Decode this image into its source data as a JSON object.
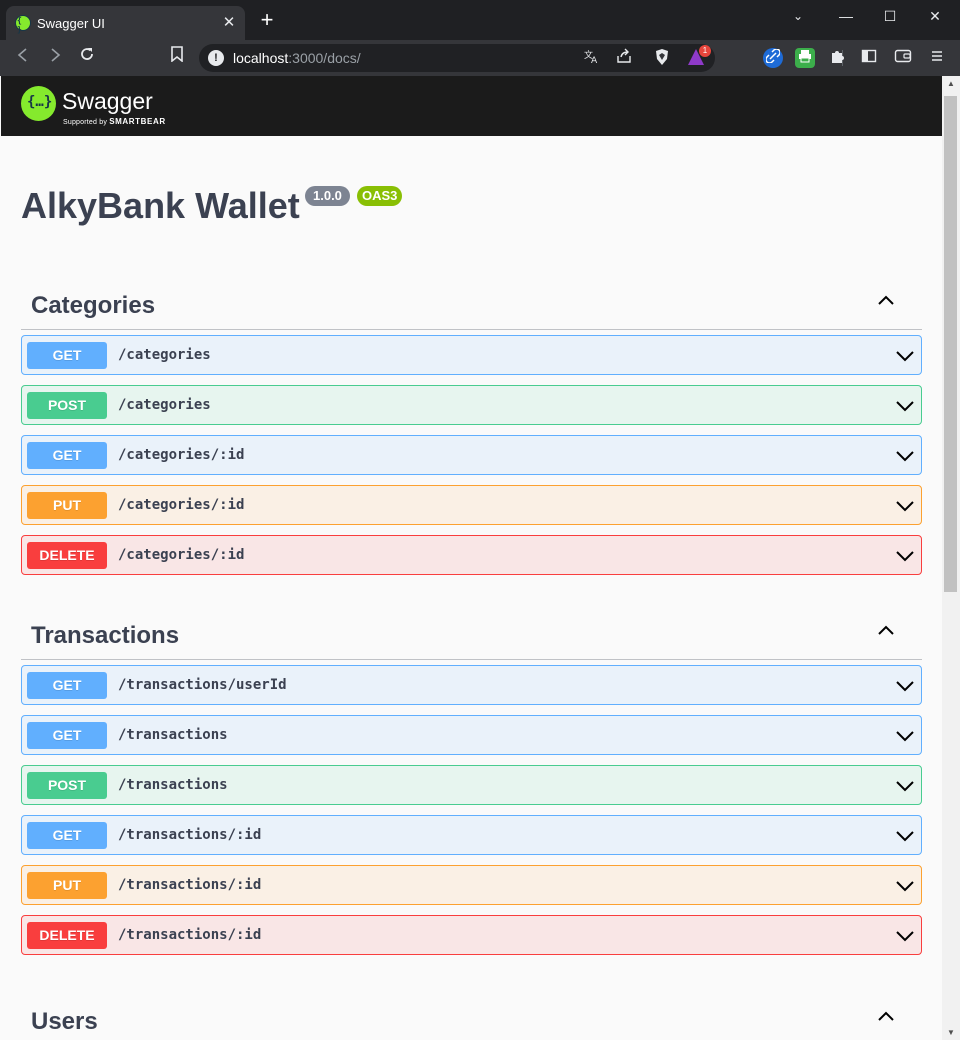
{
  "browser": {
    "tab_title": "Swagger UI",
    "tab_close": "✕",
    "new_tab": "+",
    "url_host": "localhost",
    "url_rest": ":3000/docs/",
    "rewards_count": "1",
    "window_controls": {
      "dropdown": "⌄",
      "minimize": "—",
      "maximize": "☐",
      "close": "✕"
    },
    "icons": [
      "back-icon",
      "forward-icon",
      "reload-icon",
      "bookmark-icon",
      "site-info-icon",
      "translate-icon",
      "share-icon",
      "brave-shields-icon",
      "brave-rewards-icon",
      "link-extension-icon",
      "print-extension-icon",
      "extensions-icon",
      "sidebar-icon",
      "wallet-icon",
      "menu-icon"
    ]
  },
  "swagger": {
    "logo_text": "Swagger",
    "logo_sub_prefix": "Supported by",
    "logo_sub_brand": "SMARTBEAR",
    "title": "AlkyBank Wallet",
    "version": "1.0.0",
    "oas": "OAS3"
  },
  "tags": [
    {
      "name": "Categories",
      "operations": [
        {
          "method": "GET",
          "path": "/categories"
        },
        {
          "method": "POST",
          "path": "/categories"
        },
        {
          "method": "GET",
          "path": "/categories/:id"
        },
        {
          "method": "PUT",
          "path": "/categories/:id"
        },
        {
          "method": "DELETE",
          "path": "/categories/:id"
        }
      ]
    },
    {
      "name": "Transactions",
      "operations": [
        {
          "method": "GET",
          "path": "/transactions/userId"
        },
        {
          "method": "GET",
          "path": "/transactions"
        },
        {
          "method": "POST",
          "path": "/transactions"
        },
        {
          "method": "GET",
          "path": "/transactions/:id"
        },
        {
          "method": "PUT",
          "path": "/transactions/:id"
        },
        {
          "method": "DELETE",
          "path": "/transactions/:id"
        }
      ]
    },
    {
      "name": "Users",
      "operations": []
    }
  ],
  "colors": {
    "get": "#61affe",
    "post": "#49cc90",
    "put": "#fca130",
    "delete": "#f93e3e",
    "text": "#3b4151",
    "logo_green": "#85ea2d"
  }
}
